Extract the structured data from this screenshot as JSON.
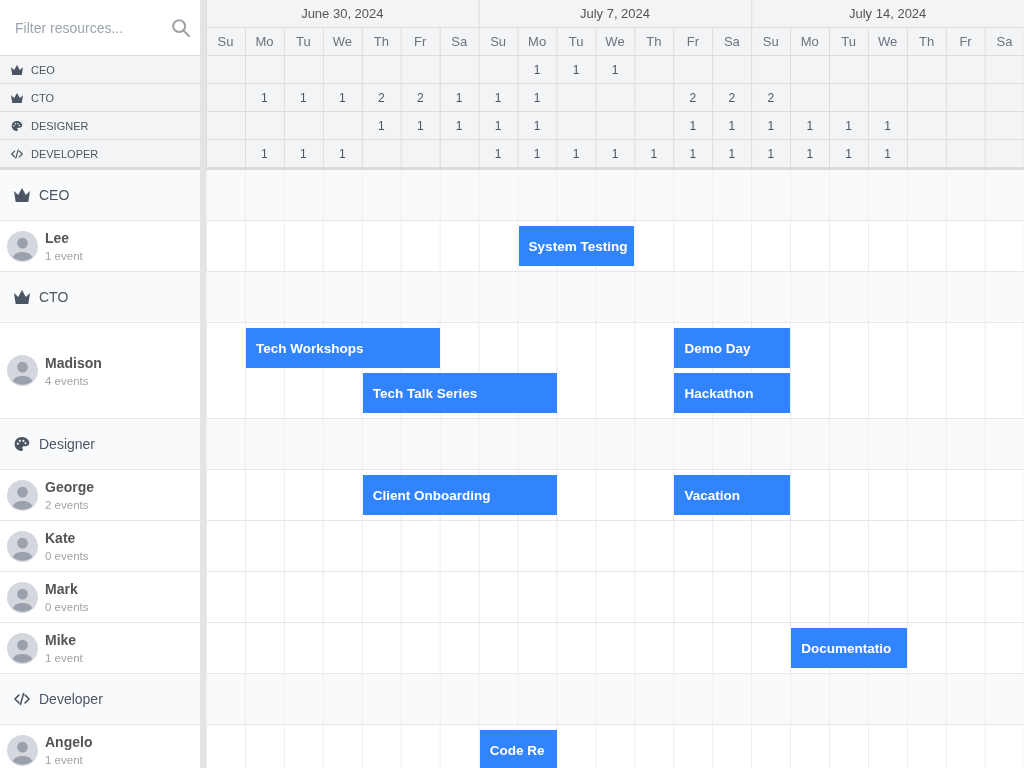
{
  "search": {
    "placeholder": "Filter resources..."
  },
  "weeks": [
    {
      "label": "June 30, 2024",
      "days": [
        "Su",
        "Mo",
        "Tu",
        "We",
        "Th",
        "Fr",
        "Sa"
      ]
    },
    {
      "label": "July 7, 2024",
      "days": [
        "Su",
        "Mo",
        "Tu",
        "We",
        "Th",
        "Fr",
        "Sa"
      ]
    },
    {
      "label": "July 14, 2024",
      "days": [
        "Su",
        "Mo",
        "Tu",
        "We",
        "Th",
        "Fr",
        "Sa"
      ]
    }
  ],
  "summary_rows": [
    {
      "label": "CEO",
      "kind": "leadership",
      "counts": [
        "1",
        "1",
        "1"
      ]
    },
    {
      "label": "CTO",
      "kind": "leadership",
      "counts": [
        "1",
        "1",
        "1",
        "2",
        "2",
        "1",
        "1",
        "1",
        "2",
        "2",
        "2"
      ]
    },
    {
      "label": "DESIGNER",
      "kind": "design",
      "counts": [
        "1",
        "1",
        "1",
        "1",
        "1",
        "1",
        "1",
        "1",
        "1",
        "1",
        "1"
      ]
    },
    {
      "label": "DEVELOPER",
      "kind": "development",
      "counts": [
        "1",
        "1",
        "1",
        "1",
        "1",
        "1",
        "1",
        "1",
        "1",
        "1",
        "1",
        "1",
        "1",
        "1"
      ]
    }
  ],
  "groups": [
    {
      "name": "CEO",
      "kind": "leadership",
      "resources": [
        {
          "name": "Lee",
          "event_count": "1 event",
          "events": [
            {
              "title": "System Testing"
            }
          ]
        }
      ]
    },
    {
      "name": "CTO",
      "kind": "leadership",
      "resources": [
        {
          "name": "Madison",
          "event_count": "4 events",
          "events": [
            {
              "title": "Tech Workshops"
            },
            {
              "title": "Tech Talk Series"
            },
            {
              "title": "Demo Day"
            },
            {
              "title": "Hackathon"
            }
          ]
        }
      ]
    },
    {
      "name": "Designer",
      "kind": "design",
      "resources": [
        {
          "name": "George",
          "event_count": "2 events",
          "events": [
            {
              "title": "Client Onboarding"
            },
            {
              "title": "Vacation"
            }
          ]
        },
        {
          "name": "Kate",
          "event_count": "0 events"
        },
        {
          "name": "Mark",
          "event_count": "0 events"
        },
        {
          "name": "Mike",
          "event_count": "1 event",
          "events": [
            {
              "title": "Documentatio"
            }
          ]
        }
      ]
    },
    {
      "name": "Developer",
      "kind": "development",
      "resources": [
        {
          "name": "Angelo",
          "event_count": "1 event",
          "events": [
            {
              "title": "Code Re"
            }
          ]
        }
      ]
    }
  ]
}
